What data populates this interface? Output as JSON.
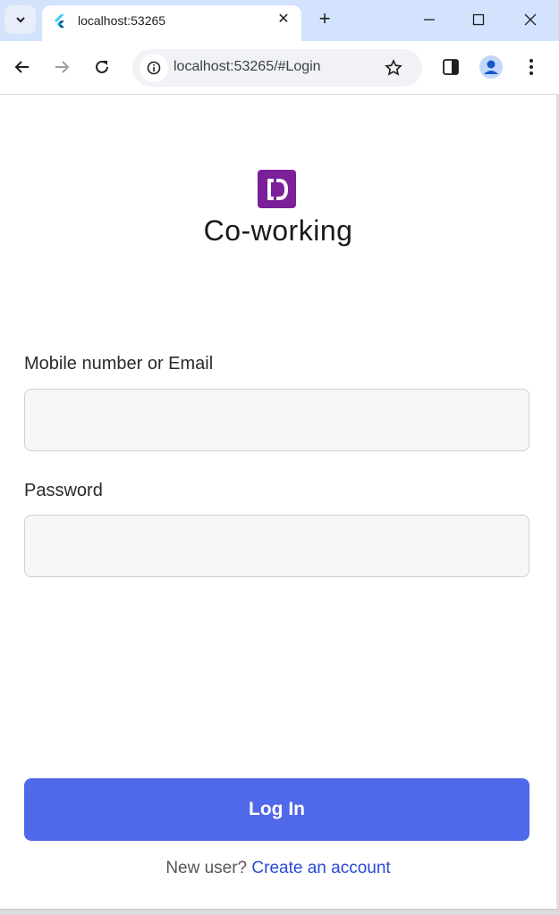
{
  "browser": {
    "tab_title": "localhost:53265",
    "url": "localhost:53265/#Login"
  },
  "app": {
    "title": "Co-working",
    "logo_letter": "D"
  },
  "form": {
    "email_label": "Mobile number or Email",
    "email_value": "",
    "password_label": "Password",
    "password_value": "",
    "login_label": "Log In",
    "new_user_text": "New user?",
    "create_account_link": "Create an account"
  },
  "colors": {
    "accent": "#5068ea",
    "logo_bg": "#7b1f9a",
    "link": "#2b49d6"
  }
}
